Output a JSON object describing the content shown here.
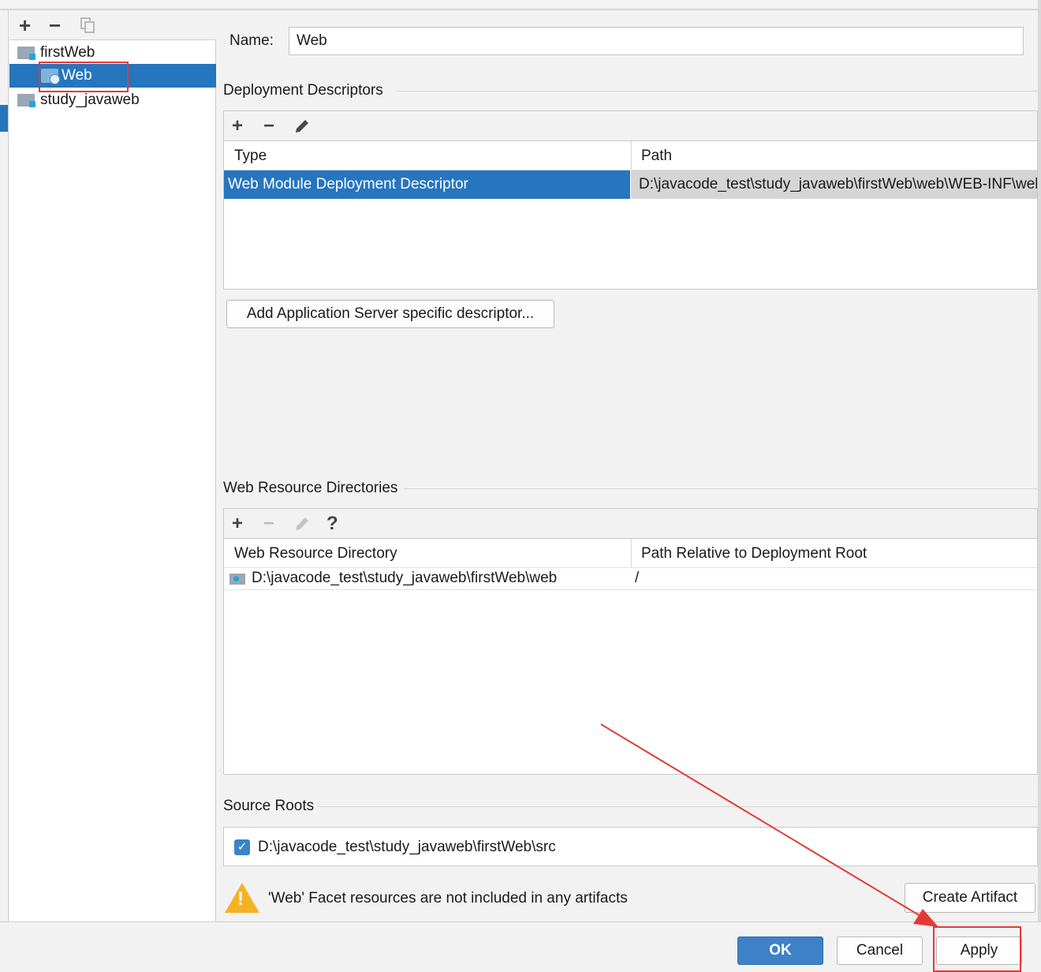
{
  "tree": {
    "toolbar": {
      "add": "+",
      "remove": "−",
      "copy_icon": "copy-icon"
    },
    "items": [
      {
        "label": "firstWeb",
        "icon": "module-folder-icon"
      },
      {
        "label": "Web",
        "icon": "web-facet-icon",
        "selected": true
      },
      {
        "label": "study_javaweb",
        "icon": "module-folder-icon"
      }
    ]
  },
  "name_field": {
    "label": "Name:",
    "value": "Web"
  },
  "deployment_descriptors": {
    "title": "Deployment Descriptors",
    "toolbar": {
      "add": "+",
      "remove": "−",
      "edit_icon": "pencil-icon"
    },
    "columns": [
      "Type",
      "Path"
    ],
    "rows": [
      {
        "type": "Web Module Deployment Descriptor",
        "path": "D:\\javacode_test\\study_javaweb\\firstWeb\\web\\WEB-INF\\web.xml"
      }
    ],
    "add_server_button": "Add Application Server specific descriptor..."
  },
  "web_resource_directories": {
    "title": "Web Resource Directories",
    "toolbar": {
      "add": "+",
      "remove": "−",
      "edit_icon": "pencil-icon",
      "help": "?"
    },
    "columns": [
      "Web Resource Directory",
      "Path Relative to Deployment Root"
    ],
    "rows": [
      {
        "directory": "D:\\javacode_test\\study_javaweb\\firstWeb\\web",
        "relative": "/"
      }
    ]
  },
  "source_roots": {
    "title": "Source Roots",
    "items": [
      {
        "checked": true,
        "path": "D:\\javacode_test\\study_javaweb\\firstWeb\\src"
      }
    ]
  },
  "warning": {
    "text": "'Web' Facet resources are not included in any artifacts",
    "button": "Create Artifact"
  },
  "footer": {
    "ok": "OK",
    "cancel": "Cancel",
    "apply": "Apply"
  },
  "colors": {
    "selection": "#2675bf",
    "primary_button": "#3d82c8",
    "annotation": "#e53935",
    "warning": "#f5b224"
  }
}
